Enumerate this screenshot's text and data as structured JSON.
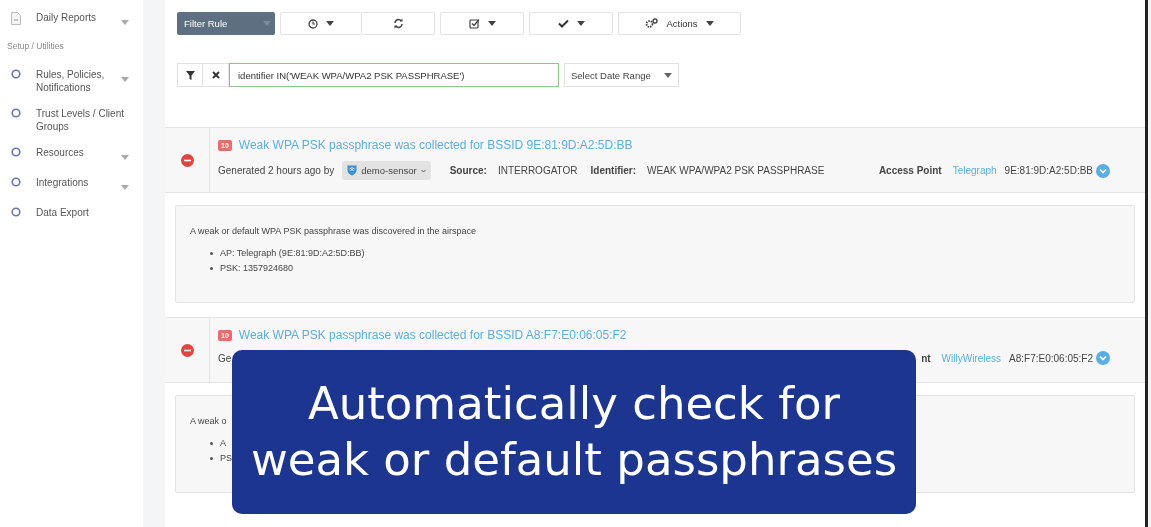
{
  "sidebar": {
    "items": [
      {
        "label": "Daily Reports",
        "caret": true
      },
      {
        "kind": "section",
        "label": "Setup / Utilities"
      },
      {
        "label": "Rules, Policies, Notifications",
        "caret": true
      },
      {
        "label": "Trust Levels / Client Groups",
        "caret": false
      },
      {
        "label": "Resources",
        "caret": true
      },
      {
        "label": "Integrations",
        "caret": true
      },
      {
        "label": "Data Export",
        "caret": false
      }
    ]
  },
  "toolbar": {
    "filter_rule": "Filter Rule",
    "buttons": [
      {
        "caret": true
      },
      {
        "caret": false
      },
      {
        "caret": true
      },
      {
        "caret": true
      },
      {
        "label": "Actions",
        "caret": true
      }
    ]
  },
  "filter": {
    "value": "identifier IN('WEAK WPA/WPA2 PSK PASSPHRASE')",
    "date_range": "Select Date Range"
  },
  "alerts": [
    {
      "badge": "10",
      "title": "Weak WPA PSK passphrase was collected for BSSID 9E:81:9D:A2:5D:BB",
      "generated": "Generated 2 hours ago by",
      "sensor": "demo-sensor",
      "source_label": "Source:",
      "source": "INTERROGATOR",
      "identifier_label": "Identifier:",
      "identifier": "WEAK WPA/WPA2 PSK PASSPHRASE",
      "ap_label": "Access Point",
      "ap_name": "Telegraph",
      "ap_mac": "9E:81:9D:A2:5D:BB",
      "description": "A weak or default WPA PSK passphrase was discovered in the airspace",
      "bullets": [
        "AP: Telegraph (9E:81:9D:A2:5D:BB)",
        "PSK: 1357924680"
      ]
    },
    {
      "badge": "10",
      "title": "Weak WPA PSK passphrase was collected for BSSID A8:F7:E0:06:05:F2",
      "generated": "Ge",
      "ap_label": "nt",
      "ap_name": "WillyWireless",
      "ap_mac": "A8:F7:E0:06:05:F2",
      "description": "A weak o",
      "bullets": [
        "A",
        "PS"
      ]
    }
  ],
  "banner": {
    "lines": [
      "Automatically check for",
      "weak or default passphrases"
    ]
  }
}
